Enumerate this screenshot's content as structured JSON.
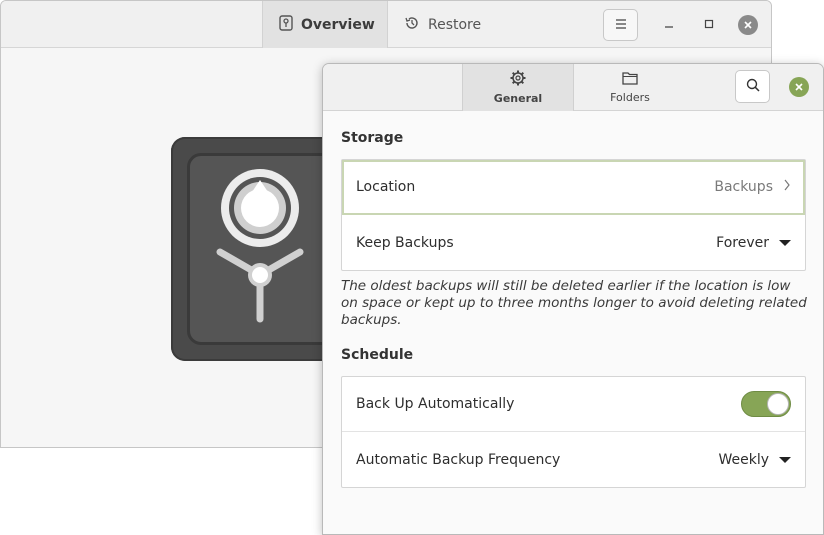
{
  "main_window": {
    "tabs": [
      {
        "label": "Overview",
        "icon": "safe-icon",
        "active": true
      },
      {
        "label": "Restore",
        "icon": "history-icon",
        "active": false
      }
    ]
  },
  "dialog": {
    "tabs": [
      {
        "label": "General",
        "icon": "gear-icon",
        "active": true
      },
      {
        "label": "Folders",
        "icon": "folder-icon",
        "active": false
      }
    ],
    "storage": {
      "title": "Storage",
      "location_label": "Location",
      "location_value": "Backups",
      "keep_label": "Keep Backups",
      "keep_value": "Forever",
      "note": "The oldest backups will still be deleted earlier if the location is low on space or kept up to three months longer to avoid deleting related backups."
    },
    "schedule": {
      "title": "Schedule",
      "auto_label": "Back Up Automatically",
      "auto_enabled": true,
      "freq_label": "Automatic Backup Frequency",
      "freq_value": "Weekly"
    }
  },
  "colors": {
    "accent": "#87a556",
    "close_inactive": "#8a8a8a"
  }
}
